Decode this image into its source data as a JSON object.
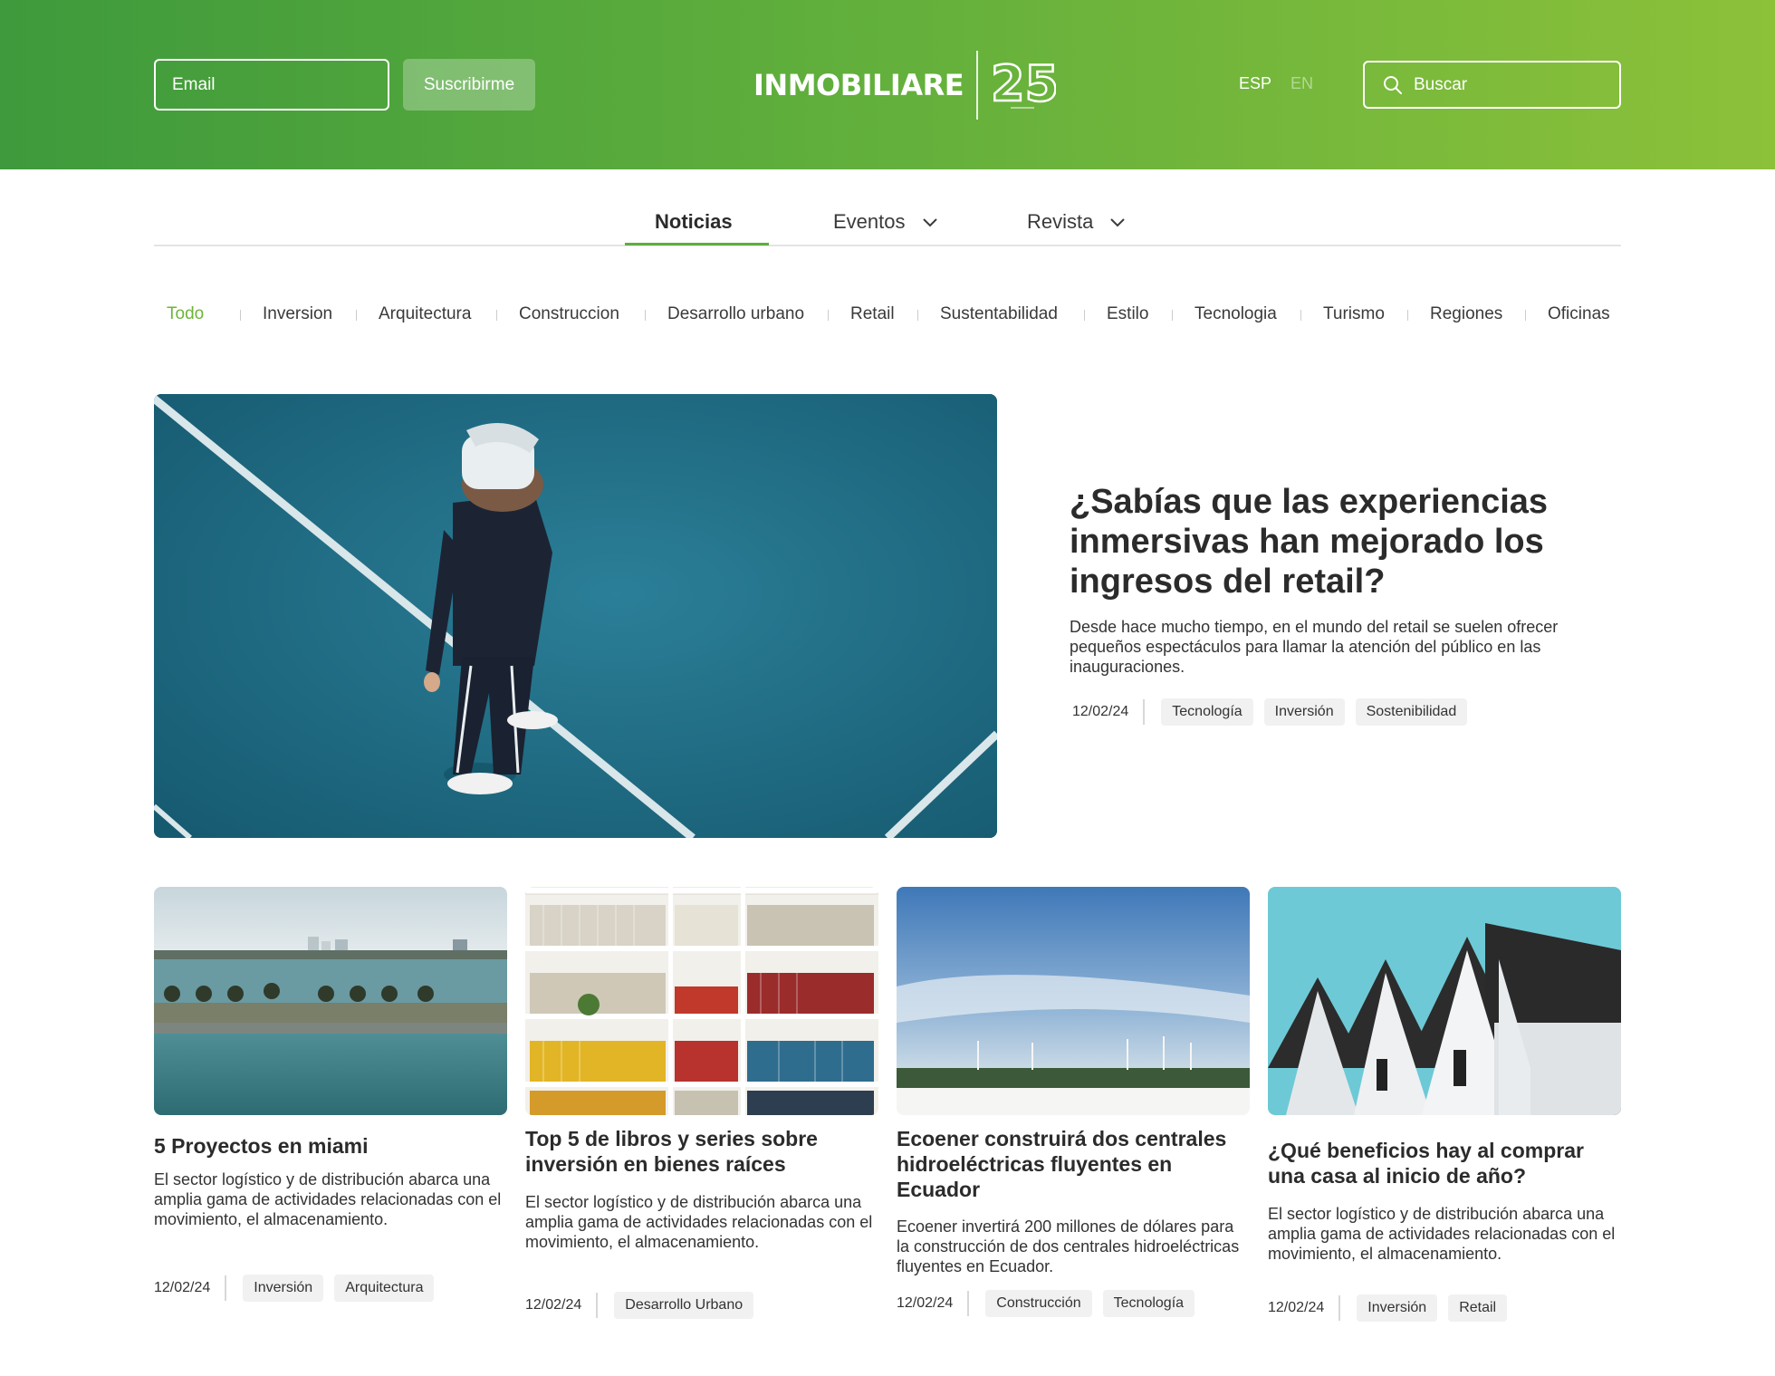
{
  "header": {
    "email_placeholder": "Email",
    "subscribe_label": "Suscribirme",
    "logo_text": "INMOBILIARE",
    "logo_anniversary": "25",
    "lang_primary": "ESP",
    "lang_secondary": "EN",
    "search_placeholder": "Buscar",
    "gradient_start": "#3e9a3c",
    "gradient_end": "#8cc13a"
  },
  "main_nav": {
    "tabs": [
      {
        "label": "Noticias",
        "active": true
      },
      {
        "label": "Eventos",
        "dropdown": true
      },
      {
        "label": "Revista",
        "dropdown": true
      }
    ]
  },
  "categories": [
    "Todo",
    "Inversion",
    "Arquitectura",
    "Construccion",
    "Desarrollo urbano",
    "Retail",
    "Sustentabilidad",
    "Estilo",
    "Tecnologia",
    "Turismo",
    "Regiones",
    "Oficinas"
  ],
  "featured": {
    "title": "¿Sabías que las experiencias inmersivas han mejorado los ingresos del retail?",
    "excerpt": "Desde hace mucho tiempo, en el mundo del retail se suelen ofrecer pequeños espectáculos para llamar la atención del público en las inauguraciones.",
    "date": "12/02/24",
    "tags": [
      "Tecnología",
      "Inversión",
      "Sostenibilidad"
    ]
  },
  "cards": [
    {
      "title": "5 Proyectos en miami",
      "excerpt": "El sector logístico y de distribución abarca una amplia gama de actividades relacionadas con el movimiento, el almacenamiento.",
      "date": "12/02/24",
      "tags": [
        "Inversión",
        "Arquitectura"
      ]
    },
    {
      "title": "Top 5 de libros y series sobre inversión en bienes raíces",
      "excerpt": "El sector logístico y de distribución abarca una amplia gama de actividades relacionadas con el movimiento, el almacenamiento.",
      "date": "12/02/24",
      "tags": [
        "Desarrollo Urbano"
      ]
    },
    {
      "title": "Ecoener construirá dos centrales hidroeléctricas fluyentes en Ecuador",
      "excerpt": "Ecoener invertirá 200 millones de dólares para la construcción de dos centrales hidroeléctricas fluyentes en Ecuador.",
      "date": "12/02/24",
      "tags": [
        "Construcción",
        "Tecnología"
      ]
    },
    {
      "title": "¿Qué beneficios hay al comprar una casa al inicio de año?",
      "excerpt": "El sector logístico y de distribución abarca una amplia gama de actividades relacionadas con el movimiento, el almacenamiento.",
      "date": "12/02/24",
      "tags": [
        "Inversión",
        "Retail"
      ]
    }
  ]
}
